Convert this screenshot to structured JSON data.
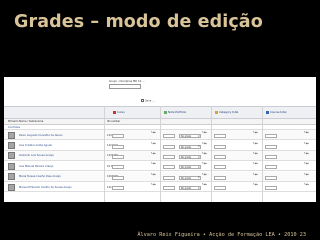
{
  "slide": {
    "title": "Grades – modo de edição",
    "footer": "Álvaro Reis Figueira • Acção de Formação LEA • 2010   23"
  },
  "screenshot": {
    "selector": {
      "label": "Grupo - Disciplina MD 10 ..."
    },
    "flag": "Save ...",
    "columns": [
      {
        "label": "Curso",
        "color": "#cc3333"
      },
      {
        "label": "Nota Portfolio",
        "color": "#66aa66"
      },
      {
        "label": "Category total",
        "color": "#d8a23a"
      },
      {
        "label": "Course total",
        "color": "#3366aa"
      }
    ],
    "table_header": {
      "name_col": "Primeiro Nome / Sobrenome",
      "id_col": "ID number"
    },
    "sub_header": "Controles",
    "dropdown_value": "No grade",
    "rows": [
      {
        "name": "Paulo Augusto Carvalho de Abreu",
        "num": "1234876"
      },
      {
        "name": "Ana Cristina Costa Aguiar",
        "num": "1421501"
      },
      {
        "name": "Godardo Luis Sousa Araújo",
        "num": "1234781"
      },
      {
        "name": "Ana Manuel Pereira Araújo",
        "num": "01 1260"
      },
      {
        "name": "Maria Teresa Coelho Dias Araújo",
        "num": "1000000"
      },
      {
        "name": "Manuel Eduardo Coelho de Sousa Araujo",
        "num": "1214888"
      }
    ]
  }
}
